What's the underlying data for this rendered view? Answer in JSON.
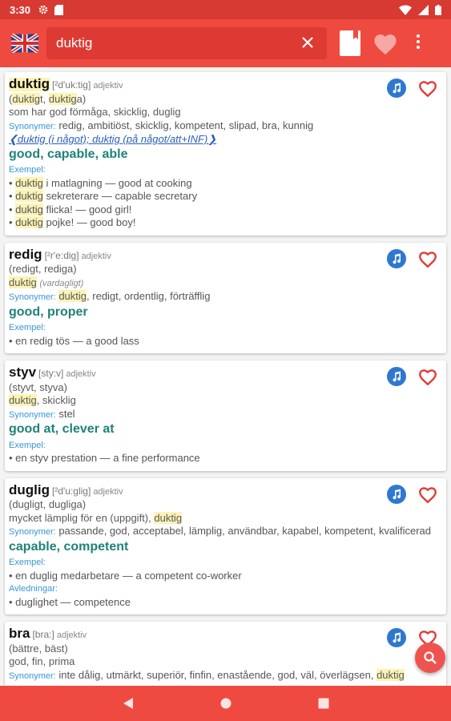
{
  "status_bar": {
    "time": "3:30",
    "left_icons": [
      "gear-icon",
      "sd-card-icon"
    ],
    "right_icons": [
      "wifi-icon",
      "signal-icon",
      "battery-icon"
    ]
  },
  "app_bar": {
    "language_flag": "uk-flag-icon",
    "search_value": "duktig",
    "actions": [
      "book-icon",
      "heart-icon",
      "more-vert-icon"
    ]
  },
  "colors": {
    "primary": "#ef4a40",
    "status": "#d63a33",
    "translation": "#1f8278",
    "label_blue": "#3796d6",
    "highlight": "#fcf3b6",
    "audio": "#2f78d0"
  },
  "entries": [
    {
      "headword": "duktig",
      "pronunciation": "[²d'uk:tig]",
      "pos": "adjektiv",
      "forms_open": "(",
      "forms_hl1": "duktig",
      "forms_mid": "t, ",
      "forms_hl2": "duktig",
      "forms_close": "a)",
      "definition": "som har god förmåga, skicklig, duglig",
      "synonyms_label": "Synonymer:",
      "synonyms": "redig, ambitiöst, skicklig, kompetent, slipad, bra, kunnig",
      "collocations": "❮duktig (i något); duktig (på något/att+INF)❯",
      "translation": "good, capable, able",
      "examples_label": "Exempel:",
      "examples": [
        {
          "hl": "duktig",
          "rest": " i matlagning — good at cooking"
        },
        {
          "hl": "duktig",
          "rest": " sekreterare — capable secretary"
        },
        {
          "hl": "duktig",
          "rest": " flicka! — good girl!"
        },
        {
          "hl": "duktig",
          "rest": " pojke! — good boy!"
        }
      ]
    },
    {
      "headword": "redig",
      "pronunciation": "[²r'e:dig]",
      "pos": "adjektiv",
      "forms": "(redigt, rediga)",
      "sense_hl": "duktig",
      "sense_note": "(vardagligt)",
      "synonyms_label": "Synonymer:",
      "synonyms_hl": "duktig",
      "synonyms_rest": ", redigt, ordentlig, förträfflig",
      "translation": "good, proper",
      "examples_label": "Exempel:",
      "examples": [
        "• en redig tös — a good lass"
      ]
    },
    {
      "headword": "styv",
      "pronunciation": "[sty:v]",
      "pos": "adjektiv",
      "forms": "(styvt, styva)",
      "sense_hl": "duktig",
      "sense_rest": ", skicklig",
      "synonyms_label": "Synonymer:",
      "synonyms": "stel",
      "translation": "good at, clever at",
      "examples_label": "Exempel:",
      "examples": [
        "• en styv prestation — a fine performance"
      ]
    },
    {
      "headword": "duglig",
      "pronunciation": "[²d'u:glig]",
      "pos": "adjektiv",
      "forms": "(dugligt, dugliga)",
      "definition_pre": "mycket lämplig för en (uppgift), ",
      "definition_hl": "duktig",
      "synonyms_label": "Synonymer:",
      "synonyms": "passande, god, acceptabel, lämplig, användbar, kapabel, kompetent, kvalificerad",
      "translation": "capable, competent",
      "examples_label": "Exempel:",
      "examples": [
        "• en duglig medarbetare — a competent co-worker"
      ],
      "derivations_label": "Avledningar:",
      "derivations": [
        "• duglighet — competence"
      ]
    },
    {
      "headword": "bra",
      "pronunciation": "[bra:]",
      "pos": "adjektiv",
      "forms": "(bättre, bäst)",
      "definition": "god, fin, prima",
      "synonyms_label": "Synonymer:",
      "synonyms": "inte dålig, utmärkt, superiör, finfin, enastående, god, väl, överlägsen, ",
      "synonyms_hl": "duktig"
    }
  ],
  "fab_icon": "search-icon",
  "nav_icons": [
    "back-icon",
    "home-icon",
    "recents-icon"
  ]
}
